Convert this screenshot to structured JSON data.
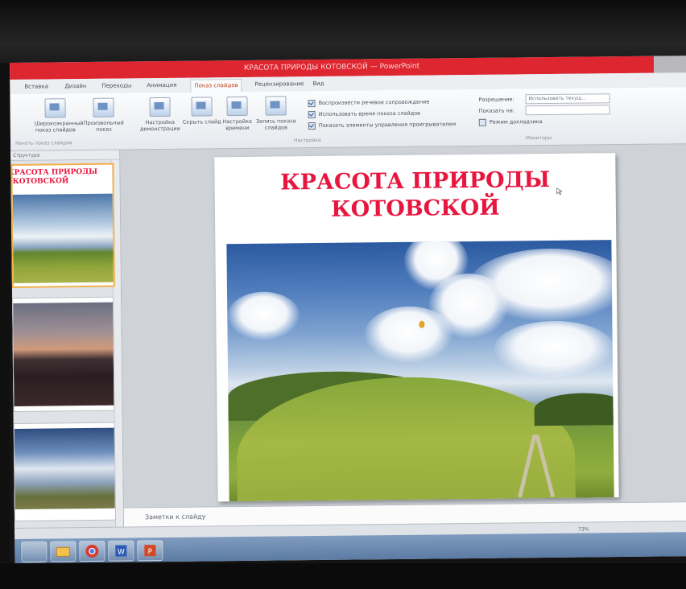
{
  "window": {
    "title": "КРАСОТА ПРИРОДЫ КОТОВСКОЙ — PowerPoint",
    "accent_color": "#e0141f"
  },
  "ribbon": {
    "tabs": [
      {
        "label": "Вставка"
      },
      {
        "label": "Дизайн"
      },
      {
        "label": "Переходы"
      },
      {
        "label": "Анимация"
      },
      {
        "label": "Показ слайдов"
      },
      {
        "label": "Рецензирование"
      },
      {
        "label": "Вид"
      }
    ],
    "buttons": [
      {
        "label": "Широкоэкранный показ слайдов",
        "icon": "widescreen-show-icon"
      },
      {
        "label": "Произвольный показ",
        "icon": "custom-show-icon"
      },
      {
        "label": "Настройка демонстрации",
        "icon": "setup-show-icon"
      },
      {
        "label": "Скрыть слайд",
        "icon": "hide-slide-icon"
      },
      {
        "label": "Настройка времени",
        "icon": "rehearse-timings-icon"
      },
      {
        "label": "Запись показа слайдов",
        "icon": "record-show-icon"
      }
    ],
    "checkboxes": [
      {
        "label": "Воспроизвести речевое сопровождение",
        "checked": true
      },
      {
        "label": "Использовать время показа слайдов",
        "checked": true
      },
      {
        "label": "Показать элементы управления проигрывателем",
        "checked": true
      },
      {
        "label": "Режим докладчика",
        "checked": false
      }
    ],
    "monitor": {
      "resolution_label": "Разрешение:",
      "resolution_value": "Использовать текущ...",
      "show_on_label": "Показать на:"
    },
    "groups": {
      "start": "Начать показ слайдов",
      "setup": "Настройка",
      "monitors": "Мониторы"
    }
  },
  "thumbnails": {
    "header": "Структура",
    "items": [
      {
        "title": "КРАСОТА ПРИРОДЫ КОТОВСКОЙ",
        "selected": true
      },
      {
        "title": "",
        "selected": false
      },
      {
        "title": "",
        "selected": false
      }
    ]
  },
  "slide": {
    "title_line1": "КРАСОТА ПРИРОДЫ",
    "title_line2": "КОТОВСКОЙ",
    "title_color": "#e8163f"
  },
  "notes": {
    "placeholder": "Заметки к слайду"
  },
  "status": {
    "zoom": "73%"
  }
}
